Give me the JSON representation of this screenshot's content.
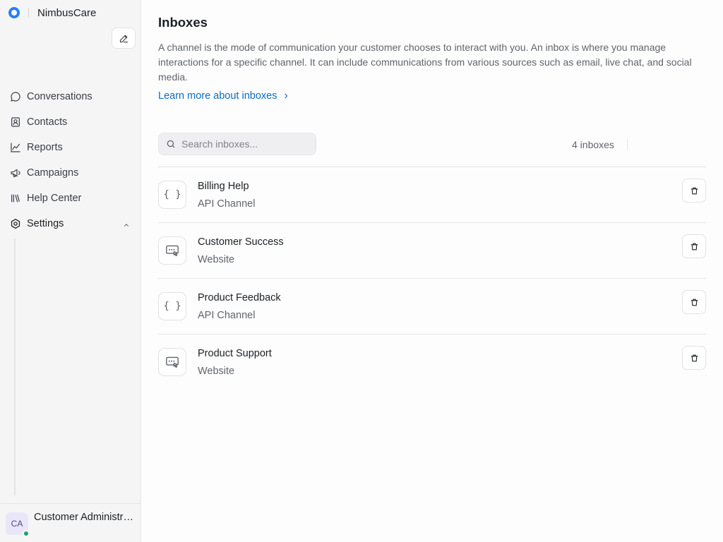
{
  "brand": {
    "name": "NimbusCare"
  },
  "sidebar": {
    "items": [
      {
        "label": "Conversations",
        "icon": "chat-bubble-icon"
      },
      {
        "label": "Contacts",
        "icon": "contact-card-icon"
      },
      {
        "label": "Reports",
        "icon": "line-chart-icon"
      },
      {
        "label": "Campaigns",
        "icon": "megaphone-icon"
      },
      {
        "label": "Help Center",
        "icon": "library-icon"
      },
      {
        "label": "Settings",
        "icon": "settings-icon",
        "expanded": true
      }
    ]
  },
  "user": {
    "initials": "CA",
    "name": "Customer Administrator",
    "status": "online",
    "status_color": "#20a06a"
  },
  "main": {
    "title": "Inboxes",
    "description": "A channel is the mode of communication your customer chooses to interact with you. An inbox is where you manage interactions for a specific channel. It can include communications from various sources such as email, live chat, and social media.",
    "learn_more": "Learn more about inboxes",
    "search_placeholder": "Search inboxes...",
    "count_label": "4 inboxes",
    "inboxes": [
      {
        "name": "Billing Help",
        "type": "API Channel",
        "icon": "api-braces-icon"
      },
      {
        "name": "Customer Success",
        "type": "Website",
        "icon": "website-chat-icon"
      },
      {
        "name": "Product Feedback",
        "type": "API Channel",
        "icon": "api-braces-icon"
      },
      {
        "name": "Product Support",
        "type": "Website",
        "icon": "website-chat-icon"
      }
    ]
  },
  "colors": {
    "accent": "#0b6cc2",
    "brand": "#2781f6"
  }
}
